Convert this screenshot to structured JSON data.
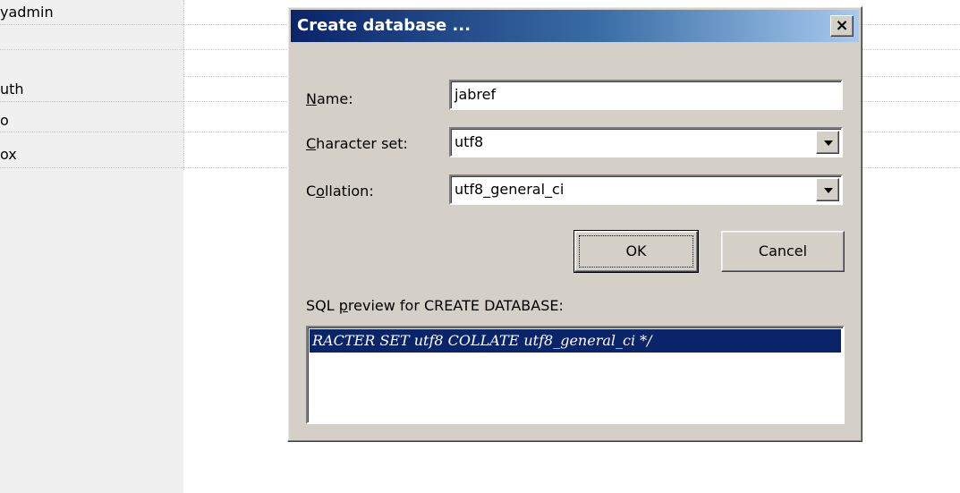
{
  "background": {
    "rows": [
      "yadmin",
      "",
      "uth",
      "o",
      "ox"
    ]
  },
  "dialog": {
    "title": "Create database ...",
    "close_glyph": "×",
    "name_label_accel": "N",
    "name_label_rest": "ame:",
    "name_value": "jabref",
    "charset_label_accel": "C",
    "charset_label_rest": "haracter set:",
    "charset_value": "utf8",
    "collation_label_pre": "C",
    "collation_label_accel": "o",
    "collation_label_rest": "llation:",
    "collation_value": "utf8_general_ci",
    "ok_label": "OK",
    "cancel_label": "Cancel",
    "preview_label_pre": "SQL ",
    "preview_label_accel": "p",
    "preview_label_rest": "review for CREATE DATABASE:",
    "preview_sql": "RACTER SET utf8 COLLATE utf8_general_ci */"
  },
  "colors": {
    "titlebar_start": "#0a246a",
    "titlebar_end": "#a6caf0",
    "dialog_face": "#d4d0c8",
    "selection": "#0a246a"
  }
}
